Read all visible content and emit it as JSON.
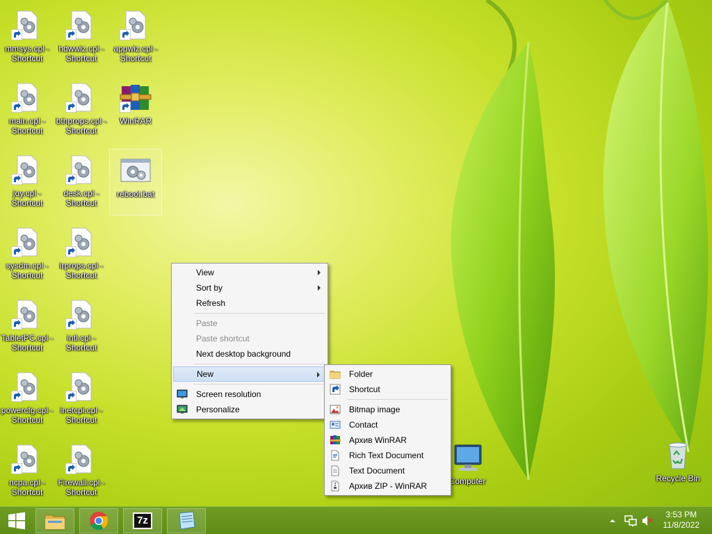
{
  "desktop": {
    "icons": [
      {
        "label": "mmsys.cpl - Shortcut",
        "type": "cpl",
        "shortcut": true
      },
      {
        "label": "hdwwiz.cpl - Shortcut",
        "type": "cpl",
        "shortcut": true
      },
      {
        "label": "appwiz.cpl - Shortcut",
        "type": "cpl",
        "shortcut": true
      },
      {
        "label": "main.cpl - Shortcut",
        "type": "cpl",
        "shortcut": true
      },
      {
        "label": "bthprops.cpl - Shortcut",
        "type": "cpl",
        "shortcut": true
      },
      {
        "label": "WinRAR",
        "type": "winrar",
        "shortcut": true
      },
      {
        "label": "joy.cpl - Shortcut",
        "type": "cpl",
        "shortcut": true
      },
      {
        "label": "desk.cpl - Shortcut",
        "type": "cpl",
        "shortcut": true
      },
      {
        "label": "reboot.bat",
        "type": "bat",
        "shortcut": false
      },
      {
        "label": "sysdm.cpl - Shortcut",
        "type": "cpl",
        "shortcut": true
      },
      {
        "label": "irprops.cpl - Shortcut",
        "type": "cpl",
        "shortcut": true
      },
      {
        "label": "TabletPC.cpl - Shortcut",
        "type": "cpl",
        "shortcut": true
      },
      {
        "label": "intl.cpl - Shortcut",
        "type": "cpl",
        "shortcut": true
      },
      {
        "label": "powercfg.cpl - Shortcut",
        "type": "cpl",
        "shortcut": true
      },
      {
        "label": "inetcpl.cpl - Shortcut",
        "type": "cpl",
        "shortcut": true
      },
      {
        "label": "ncpa.cpl - Shortcut",
        "type": "cpl",
        "shortcut": true
      },
      {
        "label": "Firewall.cpl - Shortcut",
        "type": "cpl",
        "shortcut": true
      },
      {
        "label": "Computer",
        "type": "computer",
        "shortcut": false
      },
      {
        "label": "Recycle Bin",
        "type": "recycle",
        "shortcut": false
      }
    ]
  },
  "context_menu": {
    "view": "View",
    "sort_by": "Sort by",
    "refresh": "Refresh",
    "paste": "Paste",
    "paste_shortcut": "Paste shortcut",
    "next_background": "Next desktop background",
    "new": "New",
    "screen_resolution": "Screen resolution",
    "personalize": "Personalize"
  },
  "new_submenu": {
    "folder": "Folder",
    "shortcut": "Shortcut",
    "bitmap": "Bitmap image",
    "contact": "Contact",
    "winrar_archive": "Архив WinRAR",
    "rtf": "Rich Text Document",
    "text": "Text Document",
    "zip_archive": "Архив ZIP - WinRAR"
  },
  "taskbar": {
    "pinned": [
      "file-explorer-icon",
      "chrome-icon",
      "7zip-icon",
      "notepad-icon"
    ],
    "sevenzip_label": "7z"
  },
  "clock": {
    "time": "3:53 PM",
    "date": "11/8/2022"
  }
}
